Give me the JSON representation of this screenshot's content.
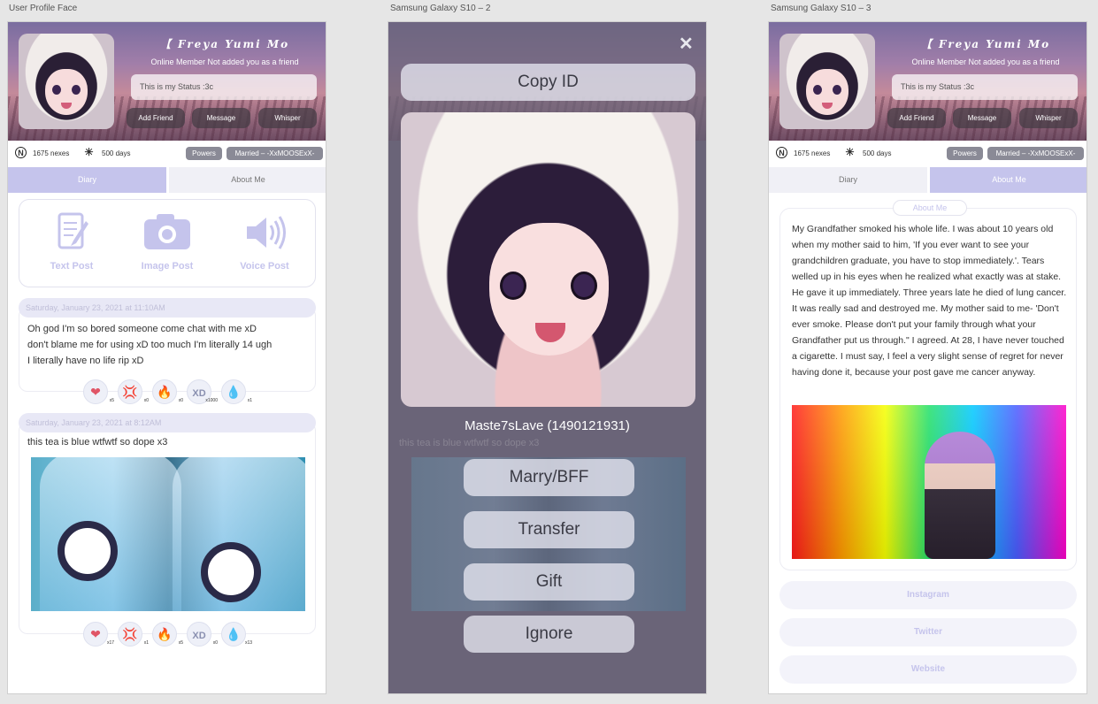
{
  "artboards": [
    "User Profile Face",
    "Samsung Galaxy S10 – 2",
    "Samsung Galaxy S10 – 3"
  ],
  "profile": {
    "username": "【 Freya Yumi Mo",
    "online_text": "Online Member Not added you as a friend",
    "status": "This is my Status :3c",
    "buttons": [
      "Add Friend",
      "Message",
      "Whisper"
    ],
    "nexes": "1675 nexes",
    "days": "500 days",
    "powers": "Powers",
    "married": "Married  –  -XxMOOSExX-",
    "tabs": [
      "Diary",
      "About Me"
    ]
  },
  "post_options": [
    "Text Post",
    "Image Post",
    "Voice Post"
  ],
  "posts": [
    {
      "date": "Saturday, January 23, 2021 at 11:10AM",
      "lines": [
        "Oh god I'm so bored someone come chat with me xD",
        "don't blame me for using xD too much I'm literally 14 ugh",
        "I literally have no life rip xD"
      ],
      "reactions": [
        {
          "icon": "heart-icon",
          "glyph": "❤",
          "count": "x5",
          "color": "#e05566"
        },
        {
          "icon": "anger-icon",
          "glyph": "💢",
          "count": "x0",
          "color": "#8a90b0"
        },
        {
          "icon": "fire-icon",
          "glyph": "🔥",
          "count": "x0",
          "color": "#8a90b0"
        },
        {
          "icon": "xd-icon",
          "glyph": "XD",
          "count": "x1000",
          "color": "#8a90b0"
        },
        {
          "icon": "drop-icon",
          "glyph": "💧",
          "count": "x1",
          "color": "#8a90b0"
        }
      ]
    },
    {
      "date": "Saturday, January 23, 2021 at 8:12AM",
      "lines": [
        "this tea is blue wtfwtf so dope x3"
      ],
      "reactions": [
        {
          "icon": "heart-icon",
          "glyph": "❤",
          "count": "x17",
          "color": "#e05566"
        },
        {
          "icon": "anger-icon",
          "glyph": "💢",
          "count": "x1",
          "color": "#e04040"
        },
        {
          "icon": "fire-icon",
          "glyph": "🔥",
          "count": "x5",
          "color": "#f08a2a"
        },
        {
          "icon": "xd-icon",
          "glyph": "XD",
          "count": "x0",
          "color": "#8a90b0"
        },
        {
          "icon": "drop-icon",
          "glyph": "💧",
          "count": "x13",
          "color": "#4a90e2"
        }
      ]
    }
  ],
  "modal": {
    "copy_id": "Copy ID",
    "user_line": "Maste7sLave (1490121931)",
    "actions": [
      "Marry/BFF",
      "Transfer",
      "Gift",
      "Ignore"
    ],
    "close": "✕"
  },
  "about": {
    "label": "About Me",
    "text": "My Grandfather smoked his whole life. I was about 10 years old when my mother said to him, 'If you ever want to see your grandchildren graduate, you have to stop immediately.'. Tears welled up in his eyes when he realized what exactly was at stake. He gave it up immediately. Three years late  he died of lung cancer. It was really sad and destroyed me. My mother said to me- 'Don't ever smoke. Please don't put your family through what your Grandfather put us through.\" I agreed. At 28, I have never touched a cigarette. I must say, I feel a very slight sense of regret for never having done it, because your post gave me cancer anyway.",
    "links": [
      "Instagram",
      "Twitter",
      "Website"
    ]
  },
  "colors": {
    "accent": "#c5c4ec",
    "pill": "#8a8a96",
    "modal_bg": "#6a6478"
  }
}
